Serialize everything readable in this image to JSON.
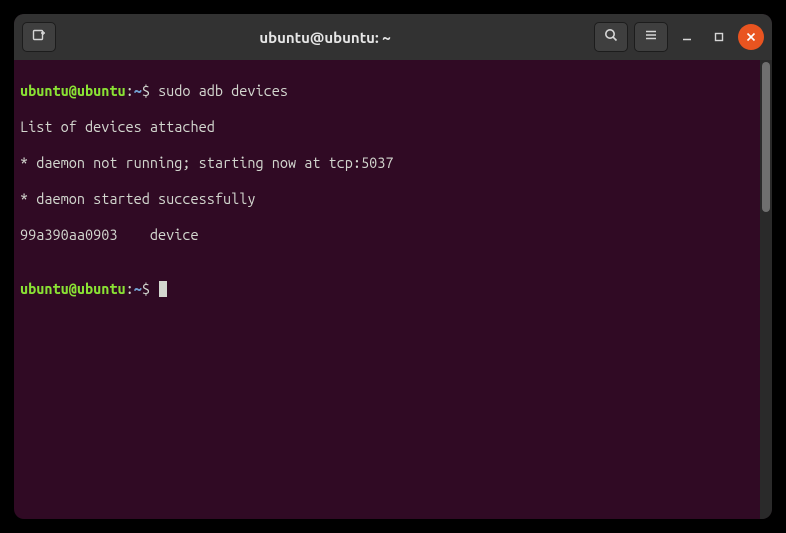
{
  "window": {
    "title": "ubuntu@ubuntu: ~"
  },
  "prompt": {
    "userhost": "ubuntu@ubuntu",
    "colon": ":",
    "path": "~",
    "dollar": "$"
  },
  "session": {
    "command1": "sudo adb devices",
    "output": [
      "List of devices attached",
      "* daemon not running; starting now at tcp:5037",
      "* daemon started successfully",
      "99a390aa0903    device"
    ]
  },
  "icons": {
    "newtab": "new-tab-icon",
    "search": "search-icon",
    "menu": "hamburger-icon",
    "minimize": "minimize-icon",
    "maximize": "maximize-icon",
    "close": "close-icon"
  }
}
